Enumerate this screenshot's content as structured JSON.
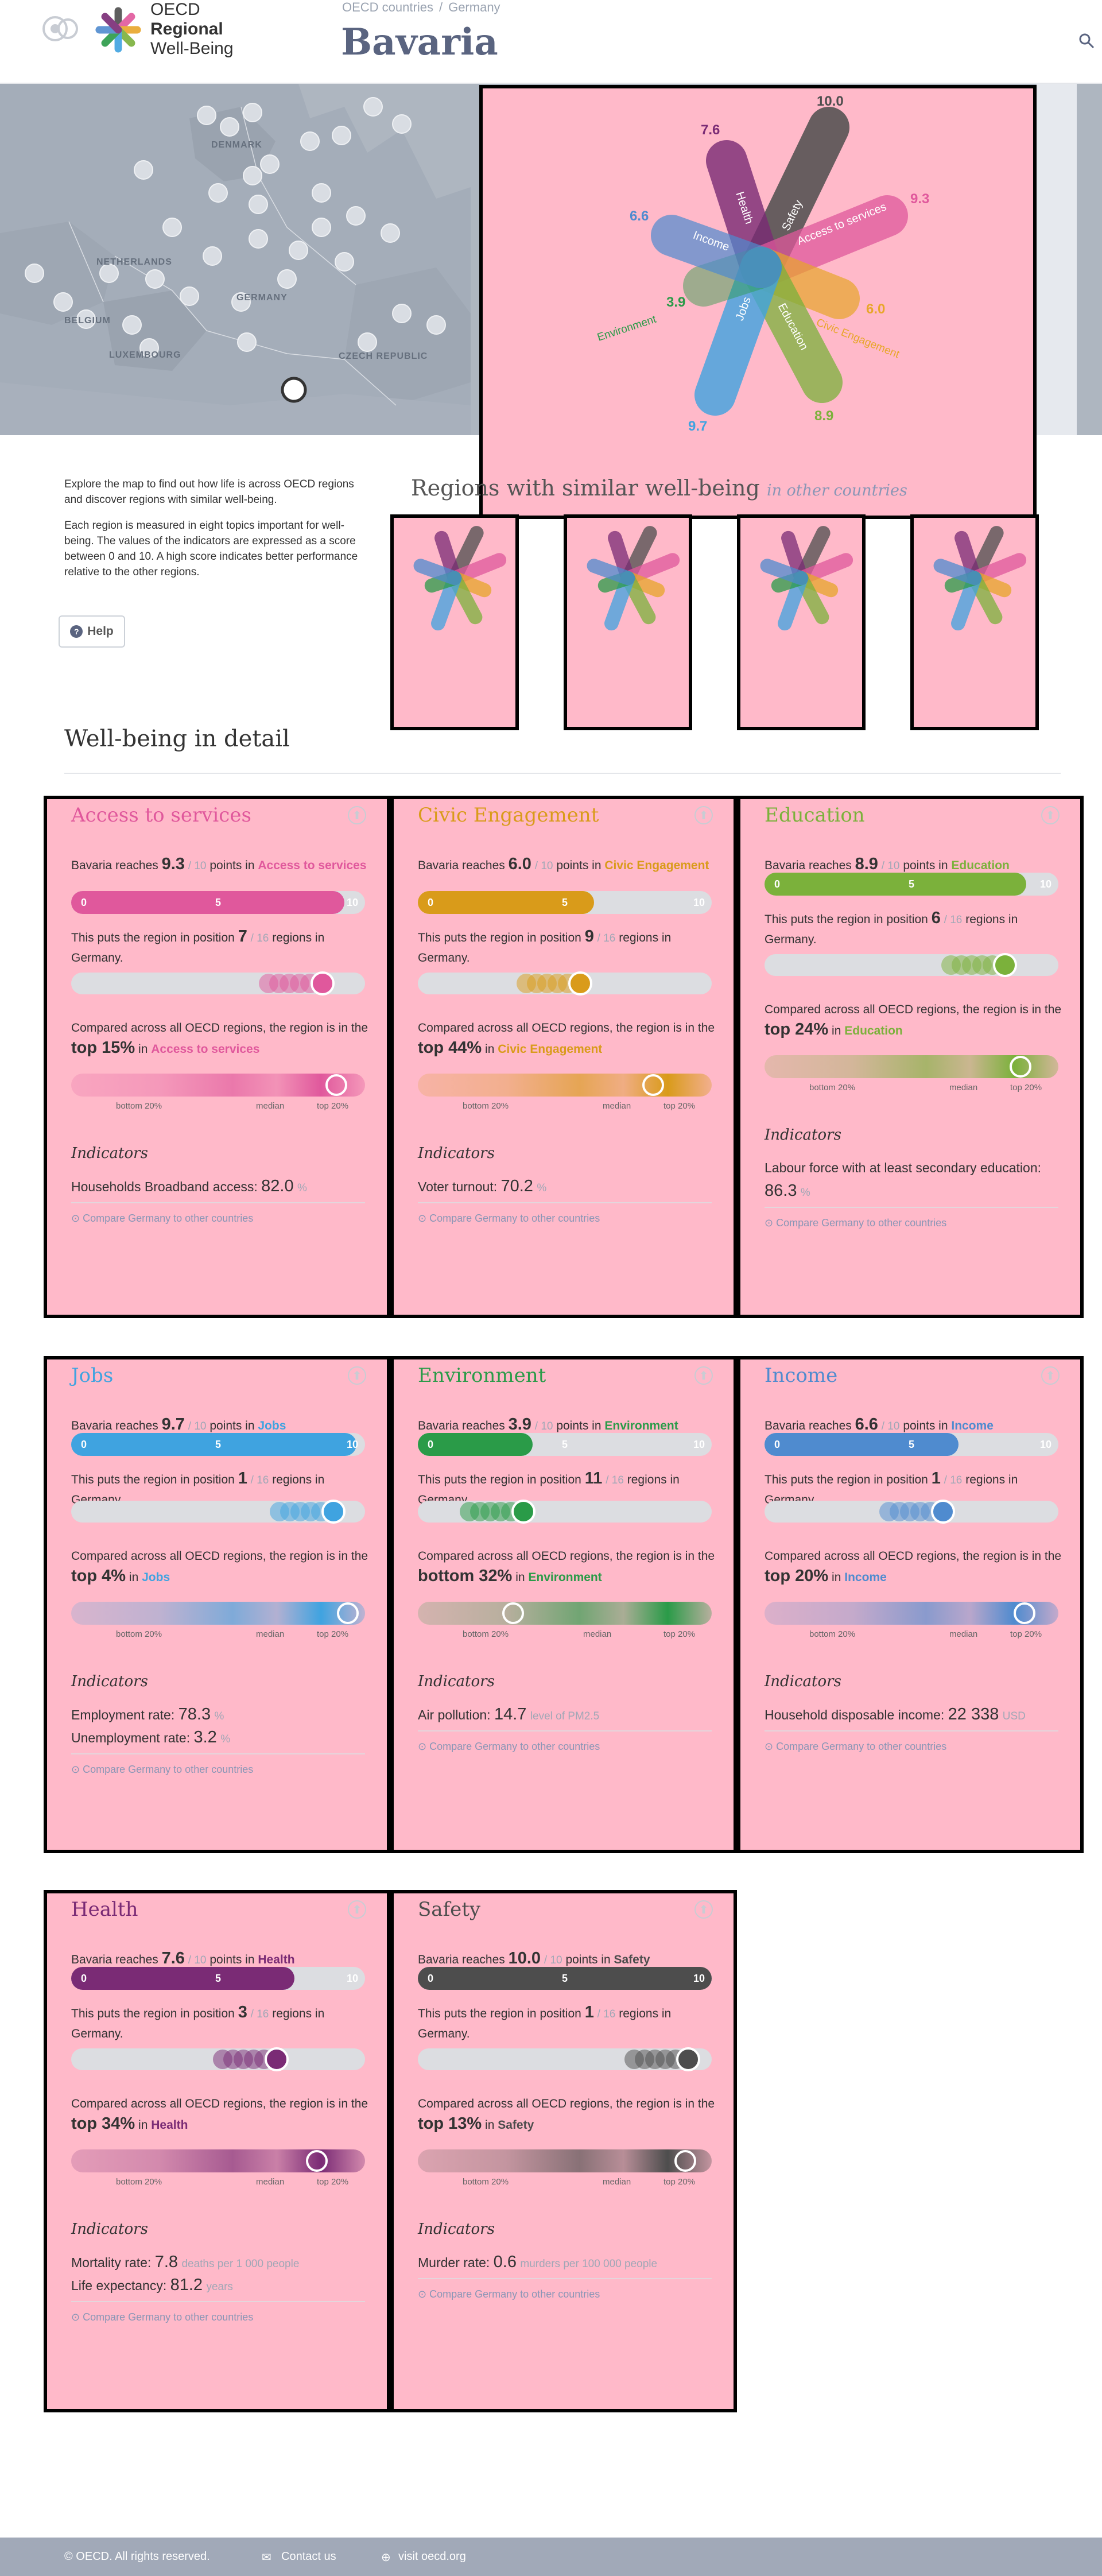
{
  "header": {
    "logo_line1": "OECD",
    "logo_line2": "Regional",
    "logo_line3": "Well-Being",
    "breadcrumb": [
      "OECD countries",
      "/",
      "Germany"
    ],
    "title": "Bavaria"
  },
  "map": {
    "labels": [
      "DENMARK",
      "NETHERLANDS",
      "GERMANY",
      "BELGIUM",
      "LUXEMBOURG",
      "CZECH REPUBLIC"
    ]
  },
  "flower": {
    "petals": [
      {
        "name": "Safety",
        "value": "10.0",
        "color": "#4d4d4d"
      },
      {
        "name": "Health",
        "value": "7.6",
        "color": "#7a2b75"
      },
      {
        "name": "Access to services",
        "value": "9.3",
        "color": "#e0589c"
      },
      {
        "name": "Civic Engagement",
        "value": "6.0",
        "color": "#e8a62a"
      },
      {
        "name": "Education",
        "value": "8.9",
        "color": "#7bb13b"
      },
      {
        "name": "Jobs",
        "value": "9.7",
        "color": "#3fa3e0"
      },
      {
        "name": "Environment",
        "value": "3.9",
        "color": "#2a9b48"
      },
      {
        "name": "Income",
        "value": "6.6",
        "color": "#4f8bcf"
      }
    ]
  },
  "intro": {
    "p1": "Explore the map to find out how life is across OECD regions and discover regions with similar well-being.",
    "p2": "Each region is measured in eight topics important for well-being. The values of the indicators are expressed as a score between 0 and 10. A high score indicates better performance relative to the other regions.",
    "help": "Help"
  },
  "similar": {
    "title": "Regions with similar well-being",
    "subtitle": "in other countries"
  },
  "detail_title": "Well-being in detail",
  "cards": [
    {
      "title": "Access to services",
      "color": "#e0589c",
      "score": "9.3",
      "rank": "7",
      "total": "/ 16",
      "top": "top 15%",
      "ind": [
        {
          "label": "Households Broadband access:",
          "value": "82.0",
          "unit": "%"
        }
      ]
    },
    {
      "title": "Civic Engagement",
      "color": "#d99b1a",
      "score": "6.0",
      "rank": "9",
      "total": "/ 16",
      "top": "top 44%",
      "ind": [
        {
          "label": "Voter turnout:",
          "value": "70.2",
          "unit": "%"
        }
      ]
    },
    {
      "title": "Education",
      "color": "#7bb13b",
      "score": "8.9",
      "rank": "6",
      "total": "/ 16",
      "top": "top 24%",
      "ind": [
        {
          "label": "Labour force with at least secondary education:",
          "value": "86.3",
          "unit": "%"
        }
      ]
    },
    {
      "title": "Jobs",
      "color": "#3fa3e0",
      "score": "9.7",
      "rank": "1",
      "total": "/ 16",
      "top": "top 4%",
      "ind": [
        {
          "label": "Employment rate:",
          "value": "78.3",
          "unit": "%"
        },
        {
          "label": "Unemployment rate:",
          "value": "3.2",
          "unit": "%"
        }
      ]
    },
    {
      "title": "Environment",
      "color": "#2a9b48",
      "score": "3.9",
      "rank": "11",
      "total": "/ 16",
      "top": "bottom 32%",
      "ind": [
        {
          "label": "Air pollution:",
          "value": "14.7",
          "unit": "level of PM2.5"
        }
      ]
    },
    {
      "title": "Income",
      "color": "#4f8bcf",
      "score": "6.6",
      "rank": "1",
      "total": "/ 16",
      "top": "top 20%",
      "ind": [
        {
          "label": "Household disposable income:",
          "value": "22 338",
          "unit": "USD"
        }
      ]
    },
    {
      "title": "Health",
      "color": "#7a2b75",
      "score": "7.6",
      "rank": "3",
      "total": "/ 16",
      "top": "top 34%",
      "ind": [
        {
          "label": "Mortality rate:",
          "value": "7.8",
          "unit": "deaths per 1 000 people"
        },
        {
          "label": "Life expectancy:",
          "value": "81.2",
          "unit": "years"
        }
      ]
    },
    {
      "title": "Safety",
      "color": "#4d4d4d",
      "score": "10.0",
      "rank": "1",
      "total": "/ 16",
      "top": "top 13%",
      "ind": [
        {
          "label": "Murder rate:",
          "value": "0.6",
          "unit": "murders per 100 000 people"
        }
      ]
    }
  ],
  "text": {
    "reaches_pre": "Bavaria reaches",
    "points_of": "/ 10",
    "points_in": "points in",
    "position_pre": "This puts the region in position",
    "regions_in": "regions in",
    "country": "Germany.",
    "compared": "Compared across all OECD regions, the region is in the",
    "in": "in",
    "indicators": "Indicators",
    "compare_link": "Compare Germany to other countries",
    "bottom20": "bottom 20%",
    "median": "median",
    "top20": "top 20%",
    "bar_ticks": [
      "0",
      "5",
      "10"
    ]
  },
  "footer": {
    "copyright": "© OECD. All rights reserved.",
    "contact": "Contact us",
    "visit": "visit oecd.org"
  }
}
